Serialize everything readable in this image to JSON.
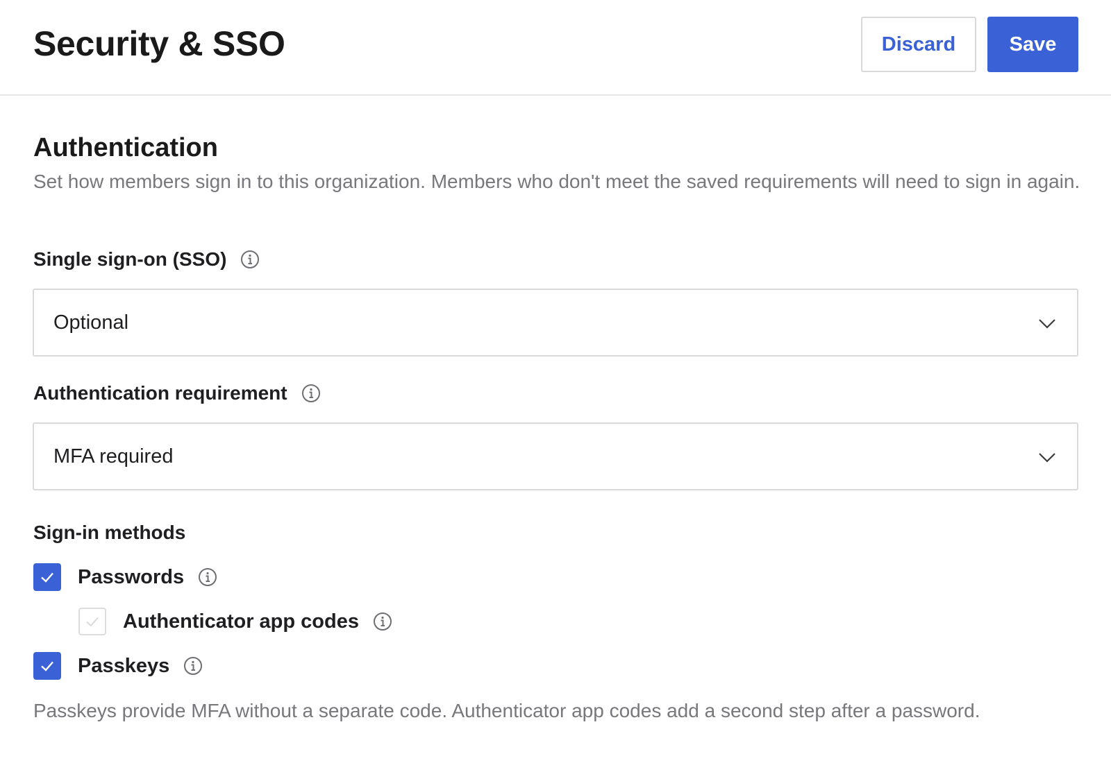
{
  "header": {
    "title": "Security & SSO",
    "discard_label": "Discard",
    "save_label": "Save"
  },
  "authentication": {
    "title": "Authentication",
    "description": "Set how members sign in to this organization. Members who don't meet the saved requirements will need to sign in again.",
    "sso": {
      "label": "Single sign-on (SSO)",
      "value": "Optional"
    },
    "requirement": {
      "label": "Authentication requirement",
      "value": "MFA required"
    },
    "methods": {
      "title": "Sign-in methods",
      "items": [
        {
          "label": "Passwords",
          "checked": true,
          "disabled": false
        },
        {
          "label": "Authenticator app codes",
          "checked": true,
          "disabled": true
        },
        {
          "label": "Passkeys",
          "checked": true,
          "disabled": false
        }
      ]
    },
    "footnote": "Passkeys provide MFA without a separate code. Authenticator app codes add a second step after a password."
  },
  "colors": {
    "accent": "#3a62d6",
    "muted_text": "#77777c",
    "border": "#d9d9dc"
  },
  "icons": {
    "info": "info-circle-icon",
    "chevron": "chevron-down-icon",
    "check": "checkmark-icon"
  }
}
